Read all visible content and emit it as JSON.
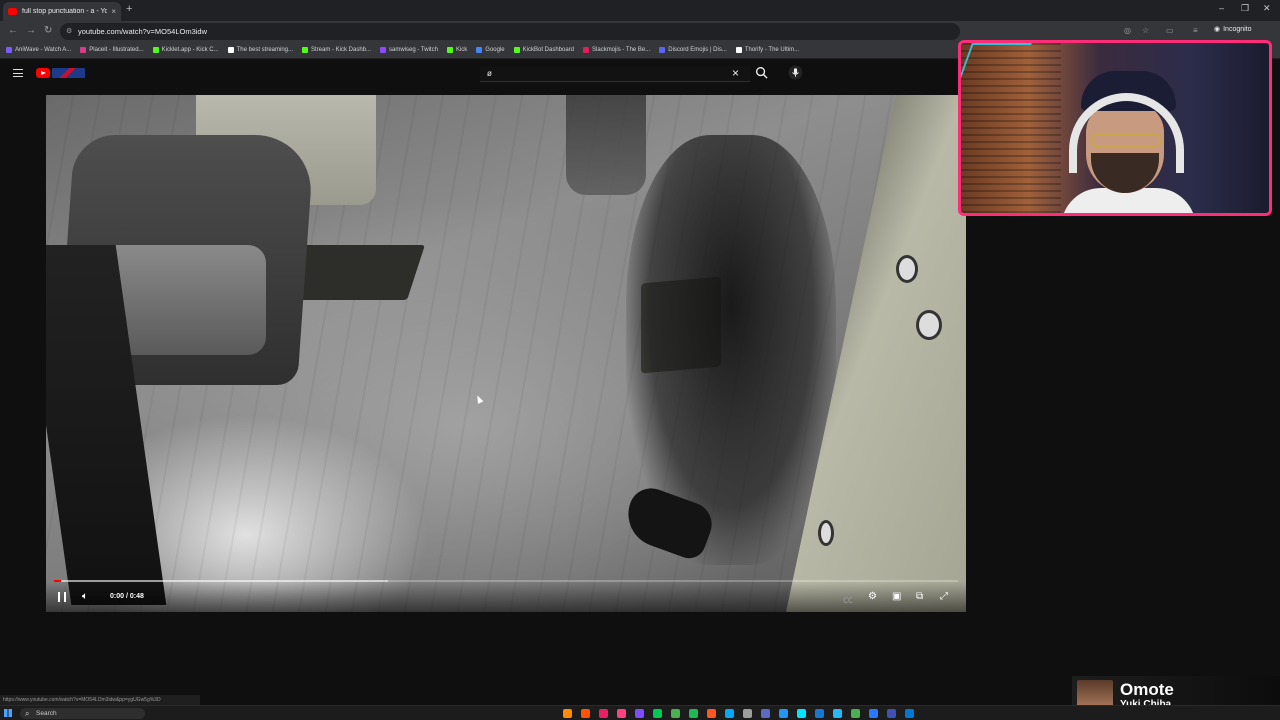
{
  "browser": {
    "tab_title": "full stop punctuation - a - YouT",
    "tab_close": "×",
    "new_tab": "+",
    "url": "youtube.com/watch?v=MO54LOm3idw",
    "profile": "Incognito",
    "bookmarks": [
      {
        "label": "AniWave - Watch A...",
        "color": "#7a5cff"
      },
      {
        "label": "Placeit - Illustrated...",
        "color": "#d43f8d"
      },
      {
        "label": "Kicklet.app - Kick C...",
        "color": "#53fc18"
      },
      {
        "label": "The best streaming...",
        "color": "#ffffff"
      },
      {
        "label": "Stream - Kick Dashb...",
        "color": "#53fc18"
      },
      {
        "label": "samwiseg - Twitch",
        "color": "#9146ff"
      },
      {
        "label": "Kick",
        "color": "#53fc18"
      },
      {
        "label": "Google",
        "color": "#4285f4"
      },
      {
        "label": "KickBot Dashboard",
        "color": "#53fc18"
      },
      {
        "label": "Slackmojis - The Be...",
        "color": "#e01e5a"
      },
      {
        "label": "Discord Emojis | Dis...",
        "color": "#5865f2"
      },
      {
        "label": "Thorify - The Ultim...",
        "color": "#ffffff"
      }
    ]
  },
  "youtube": {
    "search_query": "ø",
    "clear_icon": "×"
  },
  "player": {
    "time_display": "0:00 / 0:48",
    "played_fraction": 0.008,
    "buffered_fraction": 0.37
  },
  "status_url": "https://www.youtube.com/watch?v=MO54LOm3idw&pp=ygUGw5g%3D",
  "alert": {
    "name": "Omote",
    "subtitle": "Yuki Chiba"
  },
  "taskbar": {
    "search_label": "Search",
    "app_colors": [
      "#ff8c00",
      "#ff5500",
      "#e91e63",
      "#ff4081",
      "#7c4dff",
      "#00c853",
      "#4caf50",
      "#1db954",
      "#ff5722",
      "#03a9f4",
      "#9e9e9e",
      "#5c6bc0",
      "#2196f3",
      "#00e5ff",
      "#1976d2",
      "#29b6f6",
      "#4caf50",
      "#2979ff",
      "#3f51b5",
      "#0078d4"
    ]
  },
  "colors": {
    "accent_red": "#ff0000",
    "webcam_border": "#ff2d78"
  }
}
